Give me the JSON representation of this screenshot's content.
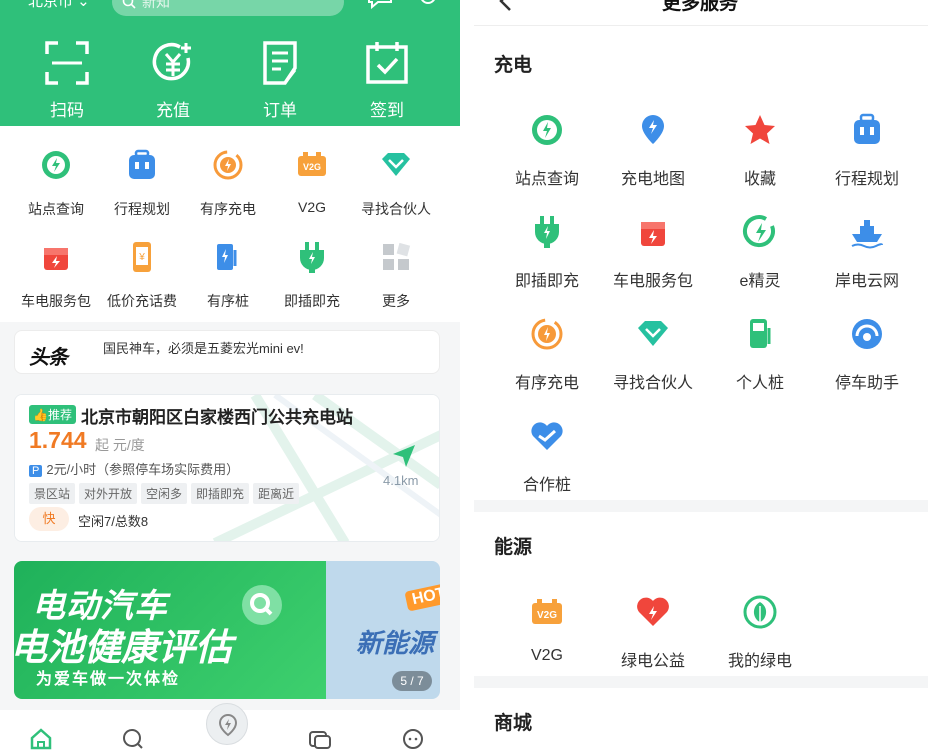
{
  "left": {
    "header": {
      "city": "北京市",
      "search_placeholder": "新知"
    },
    "quick_actions": [
      {
        "label": "扫码",
        "icon": "scan-icon"
      },
      {
        "label": "充值",
        "icon": "recharge-icon"
      },
      {
        "label": "订单",
        "icon": "order-icon"
      },
      {
        "label": "签到",
        "icon": "checkin-icon"
      }
    ],
    "grid_items": [
      {
        "label": "站点查询",
        "icon": "station-query-icon"
      },
      {
        "label": "行程规划",
        "icon": "trip-plan-icon"
      },
      {
        "label": "有序充电",
        "icon": "orderly-charge-icon"
      },
      {
        "label": "V2G",
        "icon": "v2g-icon"
      },
      {
        "label": "寻找合伙人",
        "icon": "partner-icon"
      },
      {
        "label": "车电服务包",
        "icon": "service-pack-icon"
      },
      {
        "label": "低价充话费",
        "icon": "phone-bill-icon"
      },
      {
        "label": "有序桩",
        "icon": "orderly-pile-icon"
      },
      {
        "label": "即插即充",
        "icon": "plug-charge-icon"
      },
      {
        "label": "更多",
        "icon": "more-icon"
      }
    ],
    "news": {
      "brand": "头条",
      "line1": "国民神车，必须是五菱宏光mini ev!"
    },
    "station": {
      "badge": "推荐",
      "name": "北京市朝阳区白家楼西门公共充电站",
      "price": "1.744",
      "price_unit": "起 元/度",
      "parking_tag": "P",
      "parking": "2元/小时（参照停车场实际费用）",
      "tags": [
        "景区站",
        "对外开放",
        "空闲多",
        "即插即充",
        "距离近"
      ],
      "speed": "快",
      "availability": "空闲7/总数8",
      "distance": "4.1km"
    },
    "banner": {
      "title1": "电动汽车",
      "title2": "电池健康评估",
      "subtitle": "为爱车做一次体检",
      "hot": "HOT",
      "side_text": "新能源",
      "pager": "5 / 7"
    },
    "tabbar": [
      "home-tab-icon",
      "discover-tab-icon",
      "charge-tab-icon",
      "card-tab-icon",
      "profile-tab-icon"
    ]
  },
  "right": {
    "title": "更多服务",
    "sections": [
      {
        "name": "充电",
        "items": [
          {
            "label": "站点查询",
            "icon": "station-query-icon"
          },
          {
            "label": "充电地图",
            "icon": "charge-map-icon"
          },
          {
            "label": "收藏",
            "icon": "favorite-star-icon"
          },
          {
            "label": "行程规划",
            "icon": "trip-plan-icon"
          },
          {
            "label": "即插即充",
            "icon": "plug-charge-icon"
          },
          {
            "label": "车电服务包",
            "icon": "service-pack-icon"
          },
          {
            "label": "e精灵",
            "icon": "e-sprite-icon"
          },
          {
            "label": "岸电云网",
            "icon": "shore-power-icon"
          },
          {
            "label": "有序充电",
            "icon": "orderly-charge-icon"
          },
          {
            "label": "寻找合伙人",
            "icon": "partner-icon"
          },
          {
            "label": "个人桩",
            "icon": "personal-pile-icon"
          },
          {
            "label": "停车助手",
            "icon": "parking-assistant-icon"
          },
          {
            "label": "合作桩",
            "icon": "cooperation-pile-icon"
          }
        ]
      },
      {
        "name": "能源",
        "items": [
          {
            "label": "V2G",
            "icon": "v2g-icon"
          },
          {
            "label": "绿电公益",
            "icon": "green-charity-icon"
          },
          {
            "label": "我的绿电",
            "icon": "my-green-power-icon"
          }
        ]
      },
      {
        "name": "商城",
        "items": []
      }
    ]
  },
  "colors": {
    "brand_green": "#2fc07a",
    "price_orange": "#f07a24",
    "blue": "#3d8ee8",
    "red": "#f0463c"
  }
}
